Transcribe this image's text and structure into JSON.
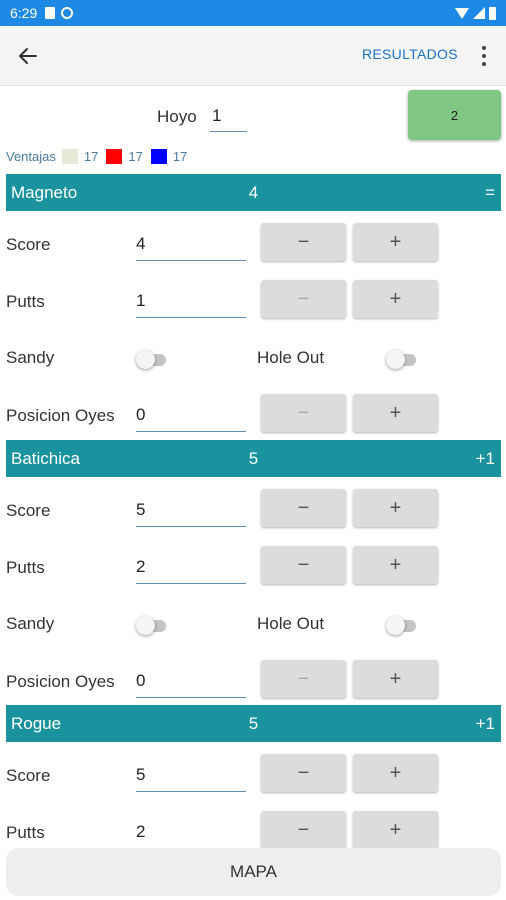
{
  "status_bar": {
    "time": "6:29"
  },
  "app_bar": {
    "results_label": "RESULTADOS"
  },
  "hole": {
    "label": "Hoyo",
    "value": "1",
    "next_button": "2"
  },
  "advantages": {
    "label": "Ventajas",
    "items": [
      {
        "color": "#e8e8d8",
        "value": "17"
      },
      {
        "color": "#ff0000",
        "value": "17"
      },
      {
        "color": "#0000ff",
        "value": "17"
      }
    ]
  },
  "labels": {
    "score": "Score",
    "putts": "Putts",
    "sandy": "Sandy",
    "hole_out": "Hole Out",
    "posicion_oyes": "Posicion Oyes",
    "minus": "−",
    "plus": "+"
  },
  "players": [
    {
      "name": "Magneto",
      "score_total": "4",
      "diff": "=",
      "score": "4",
      "putts": "1",
      "posicion_oyes": "0"
    },
    {
      "name": "Batichica",
      "score_total": "5",
      "diff": "+1",
      "score": "5",
      "putts": "2",
      "posicion_oyes": "0"
    },
    {
      "name": "Rogue",
      "score_total": "5",
      "diff": "+1",
      "score": "5",
      "putts": "2"
    }
  ],
  "map_button": "MAPA"
}
